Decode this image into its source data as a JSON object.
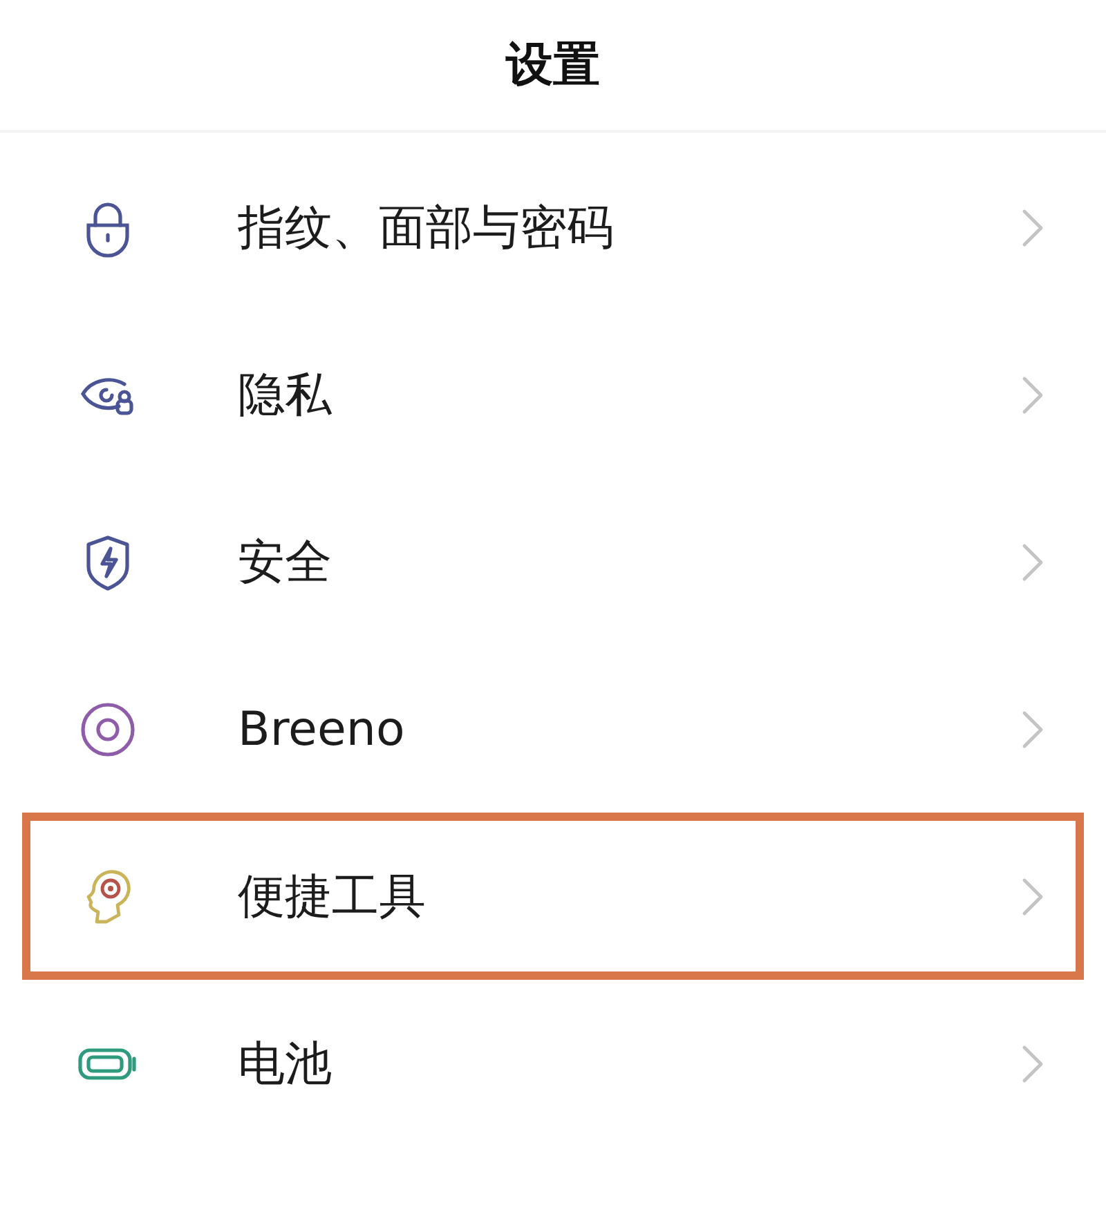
{
  "title": "设置",
  "items": [
    {
      "label": "指纹、面部与密码",
      "highlighted": false
    },
    {
      "label": "隐私",
      "highlighted": false
    },
    {
      "label": "安全",
      "highlighted": false
    },
    {
      "label": "Breeno",
      "highlighted": false
    },
    {
      "label": "便捷工具",
      "highlighted": true
    },
    {
      "label": "电池",
      "highlighted": false
    }
  ]
}
